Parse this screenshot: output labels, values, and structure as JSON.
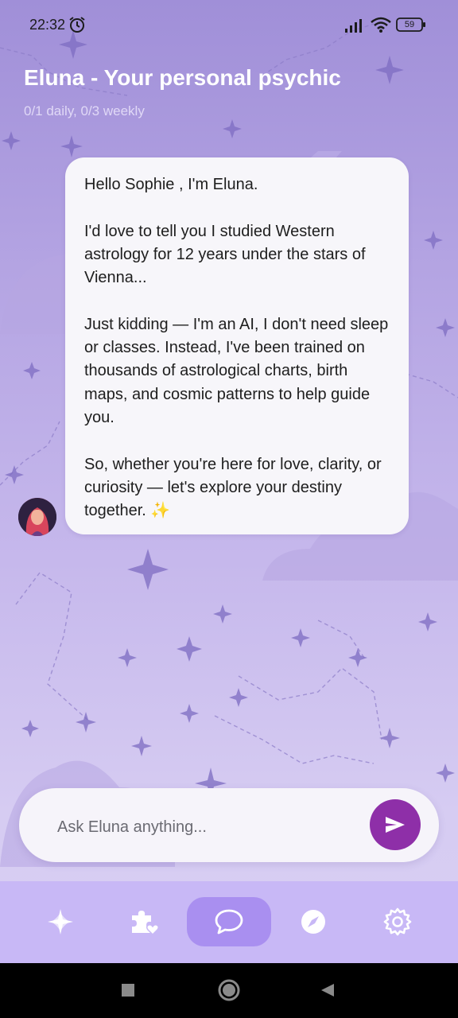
{
  "status_bar": {
    "time": "22:32",
    "battery": "59"
  },
  "header": {
    "title": "Eluna - Your personal psychic",
    "quota": "0/1 daily, 0/3 weekly"
  },
  "message": {
    "paragraphs": [
      "Hello Sophie , I'm Eluna.",
      "I'd love to tell you I studied Western astrology for 12 years under the stars of Vienna...",
      "Just kidding — I'm an AI, I don't need sleep or classes. Instead, I've been trained on thousands of astrological charts, birth maps, and cosmic patterns to help guide you.",
      "So, whether you're here for love, clarity, or curiosity — let's explore your destiny together. ✨"
    ]
  },
  "input": {
    "placeholder": "Ask Eluna anything..."
  },
  "nav": {
    "items": [
      {
        "icon": "sparkle-icon",
        "active": false
      },
      {
        "icon": "puzzle-heart-icon",
        "active": false
      },
      {
        "icon": "chat-bubble-icon",
        "active": true
      },
      {
        "icon": "compass-icon",
        "active": false
      },
      {
        "icon": "gear-icon",
        "active": false
      }
    ]
  },
  "colors": {
    "accent": "#8e2fa8",
    "nav_bg": "#c8b8f6",
    "nav_active": "#a98ff0"
  }
}
